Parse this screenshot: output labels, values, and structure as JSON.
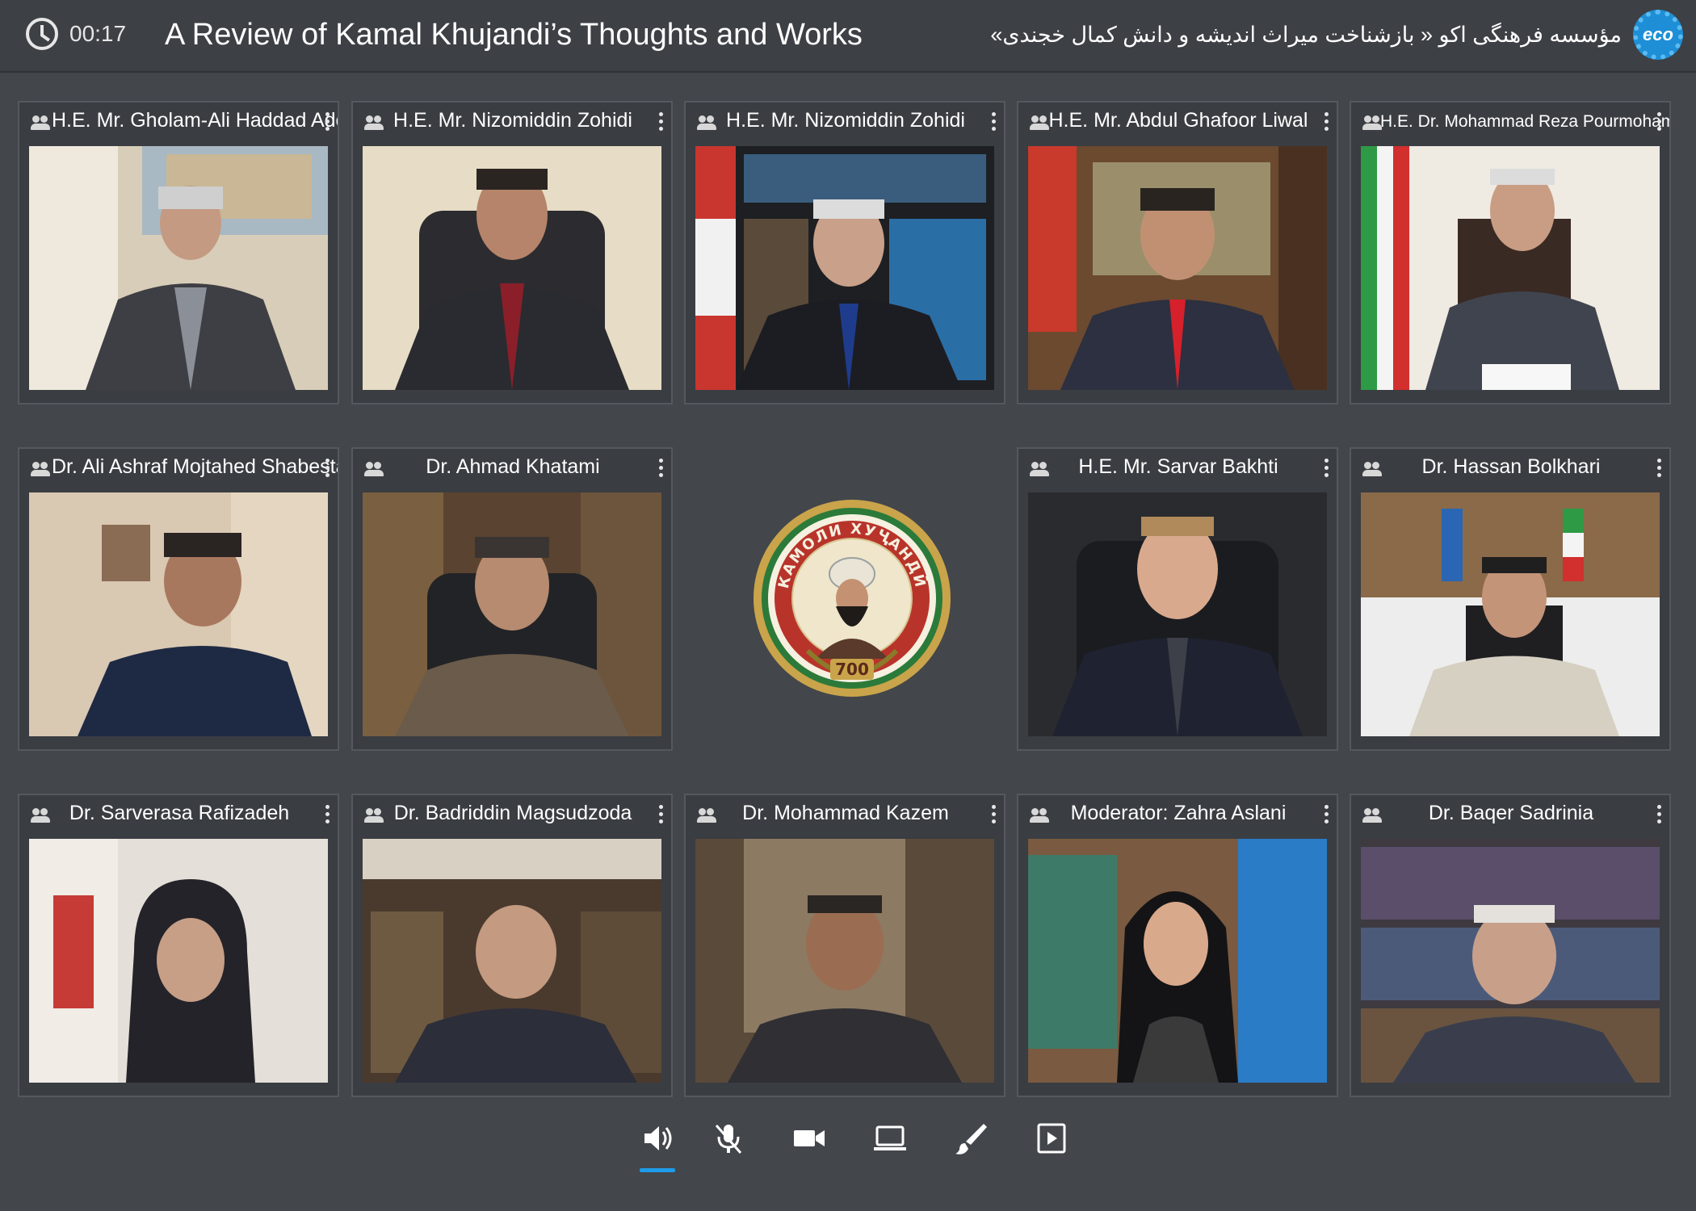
{
  "header": {
    "elapsed_time": "00:17",
    "title": "A Review of Kamal Khujandi’s Thoughts and Works",
    "organizer": "مؤسسه فرهنگی اکو « بازشناخت میراث اندیشه و دانش کمال خجندی»",
    "org_logo_text": "eco",
    "clock_icon": "clock-icon"
  },
  "participants": [
    {
      "name": "H.E. Mr. Gholam-Ali Haddad Adel"
    },
    {
      "name": "H.E. Mr. Nizomiddin Zohidi"
    },
    {
      "name": "H.E. Mr. Nizomiddin Zohidi"
    },
    {
      "name": "H.E. Mr. Abdul Ghafoor Liwal"
    },
    {
      "name": "H.E. Dr. Mohammad Reza Pourmohammadi"
    },
    {
      "name": "Dr. Ali Ashraf Mojtahed Shabestari"
    },
    {
      "name": "Dr. Ahmad Khatami"
    },
    {
      "name": "H.E. Mr. Sarvar Bakhti"
    },
    {
      "name": "Dr. Hassan Bolkhari"
    },
    {
      "name": "Dr. Sarverasa Rafizadeh"
    },
    {
      "name": "Dr. Badriddin Magsudzoda"
    },
    {
      "name": "Dr. Mohammad Kazem"
    },
    {
      "name": "Moderator: Zahra Aslani"
    },
    {
      "name": "Dr. Baqer Sadrinia"
    }
  ],
  "event_logo": {
    "arc_text": "КАМОЛИ ХУҶАНДӢ",
    "number": "700"
  },
  "toolbar": {
    "buttons": [
      {
        "name": "speaker-icon",
        "active": true
      },
      {
        "name": "mic-muted-icon",
        "active": false
      },
      {
        "name": "camera-icon",
        "active": false
      },
      {
        "name": "screen-share-icon",
        "active": false
      },
      {
        "name": "brush-icon",
        "active": false
      },
      {
        "name": "play-icon",
        "active": false
      }
    ]
  },
  "colors": {
    "background": "#43464b",
    "accent": "#1e9be8"
  }
}
